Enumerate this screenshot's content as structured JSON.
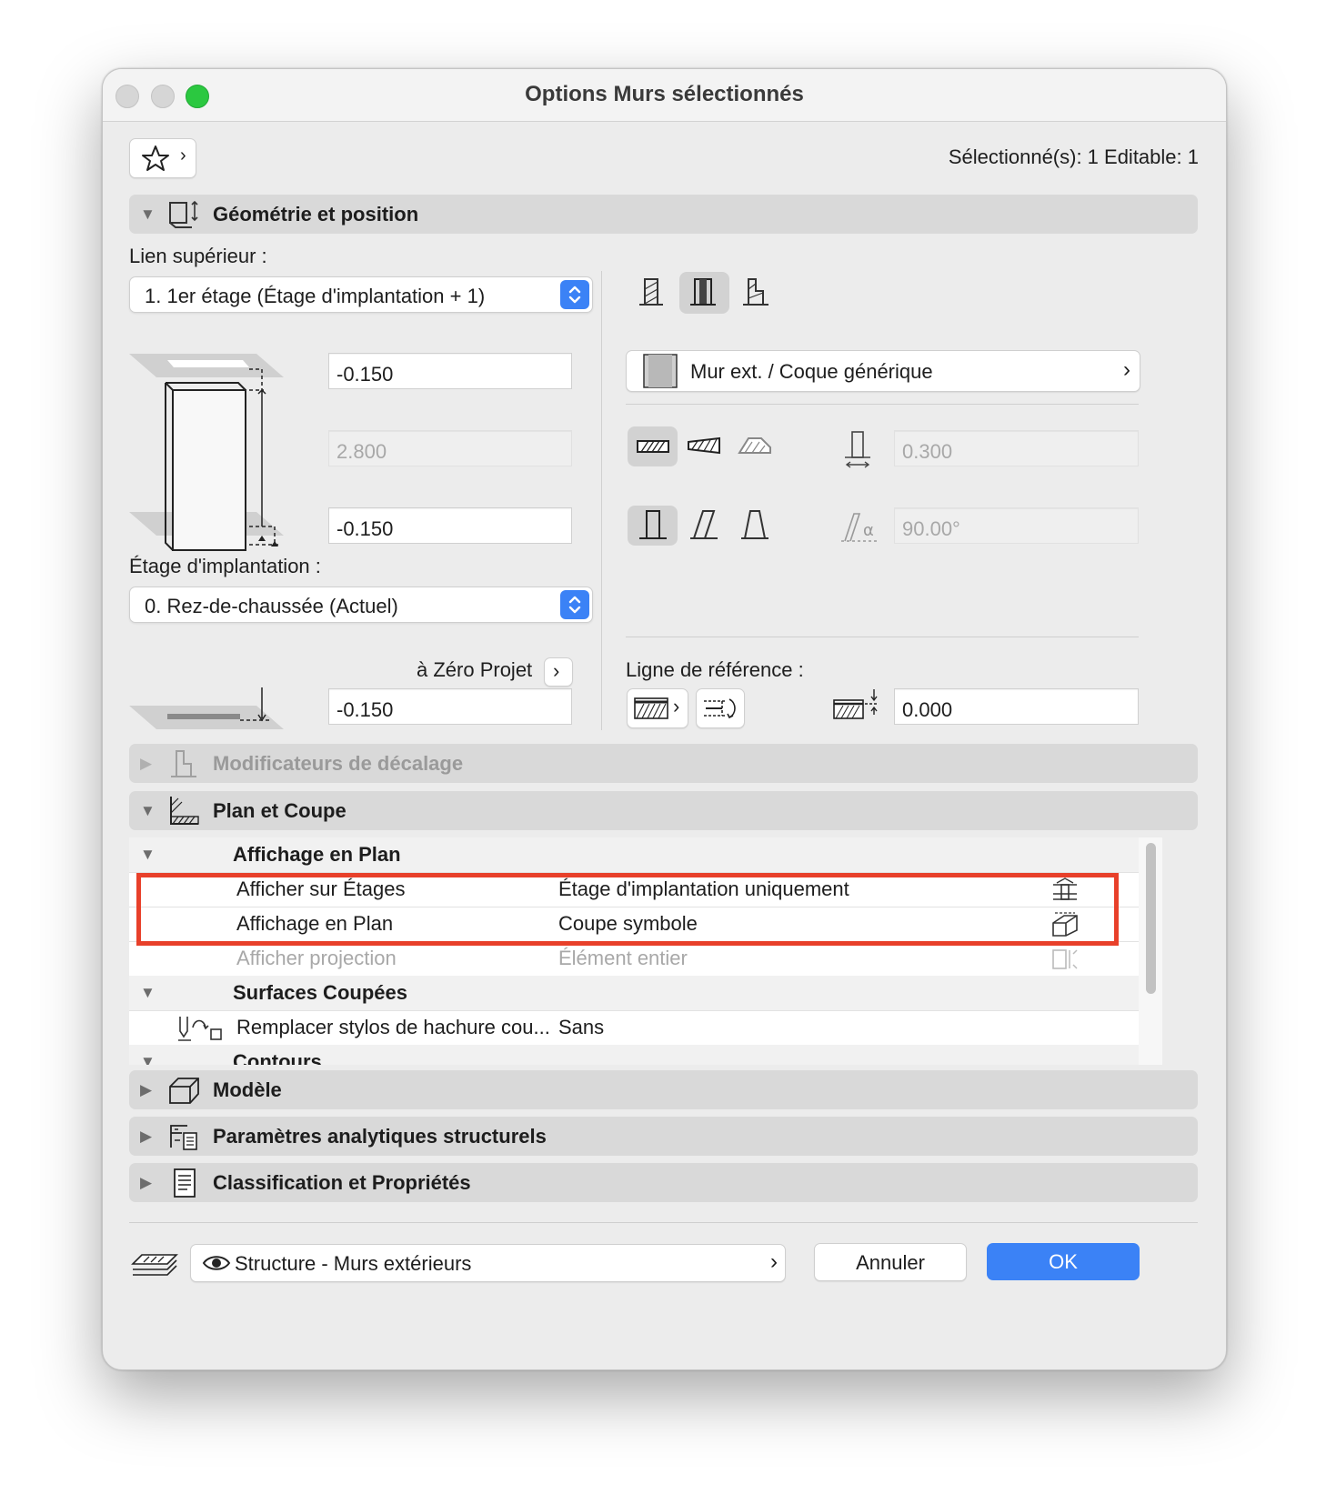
{
  "window": {
    "title": "Options Murs sélectionnés",
    "traffic_lights": {
      "close": "#d8d8d8",
      "minimize": "#d8d8d8",
      "zoom": "#2bc840"
    }
  },
  "header": {
    "favorites_icon": "star-icon",
    "selection_status": "Sélectionné(s): 1 Editable: 1"
  },
  "geometry": {
    "section_title": "Géométrie et position",
    "top_link_label": "Lien supérieur :",
    "top_link_value": "1. 1er étage (Étage d'implantation + 1)",
    "top_offset": "-0.150",
    "height": "2.800",
    "bottom_offset": "-0.150",
    "home_story_label": "Étage d'implantation :",
    "home_story_value": "0. Rez-de-chaussée (Actuel)",
    "zero_label": "à Zéro Projet",
    "zero_value": "-0.150",
    "composite_name": "Mur ext. / Coque générique",
    "thickness": "0.300",
    "angle": "90.00°",
    "ref_line_label": "Ligne de référence :",
    "ref_offset": "0.000"
  },
  "sections": {
    "offset_modifiers": "Modificateurs de décalage",
    "plan_section": "Plan et Coupe",
    "model": "Modèle",
    "structural": "Paramètres analytiques structurels",
    "classification": "Classification et Propriétés"
  },
  "plan_table": {
    "group1": "Affichage en Plan",
    "rows": [
      {
        "label": "Afficher sur Étages",
        "value": "Étage d'implantation uniquement"
      },
      {
        "label": "Affichage en Plan",
        "value": "Coupe symbole"
      },
      {
        "label": "Afficher projection",
        "value": "Élément entier"
      }
    ],
    "group2": "Surfaces Coupées",
    "row4": {
      "label": "Remplacer stylos de hachure cou...",
      "value": "Sans"
    },
    "group3": "Contours"
  },
  "footer": {
    "layer_name": "Structure - Murs extérieurs",
    "cancel_label": "Annuler",
    "ok_label": "OK"
  },
  "colors": {
    "accent": "#3b82f6",
    "highlight_border": "#e8402a"
  }
}
